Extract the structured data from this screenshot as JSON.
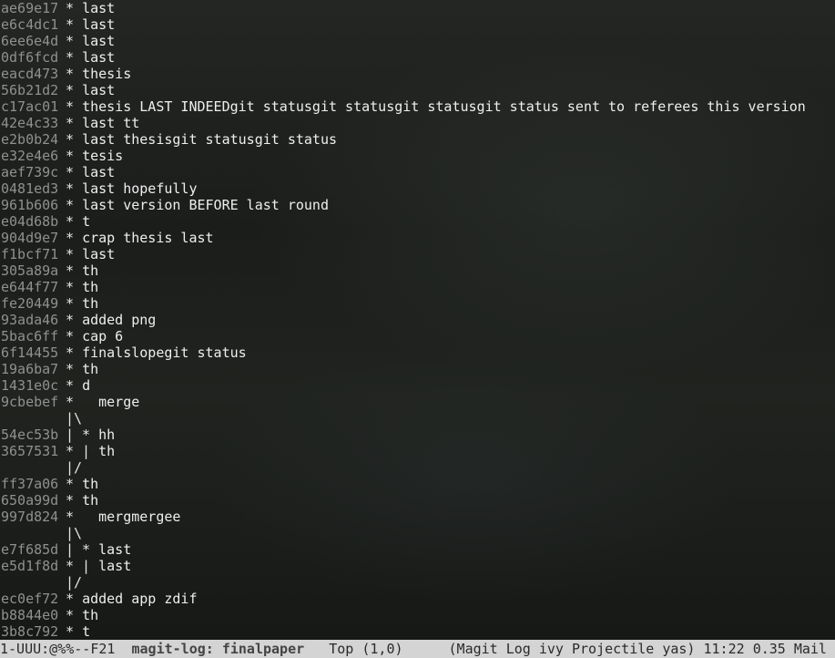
{
  "log": {
    "rows": [
      {
        "hash": "ae69e17",
        "graph": "* ",
        "message": "last"
      },
      {
        "hash": "e6c4dc1",
        "graph": "* ",
        "message": "last"
      },
      {
        "hash": "6ee6e4d",
        "graph": "* ",
        "message": "last"
      },
      {
        "hash": "0df6fcd",
        "graph": "* ",
        "message": "last"
      },
      {
        "hash": "eacd473",
        "graph": "* ",
        "message": "thesis"
      },
      {
        "hash": "56b21d2",
        "graph": "* ",
        "message": "last"
      },
      {
        "hash": "c17ac01",
        "graph": "* ",
        "message": "thesis LAST INDEEDgit statusgit statusgit statusgit status sent to referees this version"
      },
      {
        "hash": "42e4c33",
        "graph": "* ",
        "message": "last tt"
      },
      {
        "hash": "e2b0b24",
        "graph": "* ",
        "message": "last thesisgit statusgit status"
      },
      {
        "hash": "e32e4e6",
        "graph": "* ",
        "message": "tesis"
      },
      {
        "hash": "aef739c",
        "graph": "* ",
        "message": "last"
      },
      {
        "hash": "0481ed3",
        "graph": "* ",
        "message": "last hopefully"
      },
      {
        "hash": "961b606",
        "graph": "* ",
        "message": "last version BEFORE last round"
      },
      {
        "hash": "e04d68b",
        "graph": "* ",
        "message": "t"
      },
      {
        "hash": "904d9e7",
        "graph": "* ",
        "message": "crap thesis last"
      },
      {
        "hash": "f1bcf71",
        "graph": "* ",
        "message": "last"
      },
      {
        "hash": "305a89a",
        "graph": "* ",
        "message": "th"
      },
      {
        "hash": "e644f77",
        "graph": "* ",
        "message": "th"
      },
      {
        "hash": "fe20449",
        "graph": "* ",
        "message": "th"
      },
      {
        "hash": "93ada46",
        "graph": "* ",
        "message": "added png"
      },
      {
        "hash": "5bac6ff",
        "graph": "* ",
        "message": "cap 6"
      },
      {
        "hash": "6f14455",
        "graph": "* ",
        "message": "finalslopegit status"
      },
      {
        "hash": "19a6ba7",
        "graph": "* ",
        "message": "th"
      },
      {
        "hash": "1431e0c",
        "graph": "* ",
        "message": "d"
      },
      {
        "hash": "9cbebef",
        "graph": "*   ",
        "message": "merge"
      },
      {
        "hash": "",
        "graph": "|\\",
        "message": ""
      },
      {
        "hash": "54ec53b",
        "graph": "| * ",
        "message": "hh"
      },
      {
        "hash": "3657531",
        "graph": "* | ",
        "message": "th"
      },
      {
        "hash": "",
        "graph": "|/",
        "message": ""
      },
      {
        "hash": "ff37a06",
        "graph": "* ",
        "message": "th"
      },
      {
        "hash": "650a99d",
        "graph": "* ",
        "message": "th"
      },
      {
        "hash": "997d824",
        "graph": "*   ",
        "message": "mergmergee"
      },
      {
        "hash": "",
        "graph": "|\\",
        "message": ""
      },
      {
        "hash": "e7f685d",
        "graph": "| * ",
        "message": "last"
      },
      {
        "hash": "e5d1f8d",
        "graph": "* | ",
        "message": "last"
      },
      {
        "hash": "",
        "graph": "|/",
        "message": ""
      },
      {
        "hash": "ec0ef72",
        "graph": "* ",
        "message": "added app zdif"
      },
      {
        "hash": "b8844e0",
        "graph": "* ",
        "message": "th"
      },
      {
        "hash": "3b8c792",
        "graph": "* ",
        "message": "t"
      }
    ]
  },
  "modeline": {
    "state": "1-UUU:@%%--F21",
    "buffer": "magit-log: finalpaper",
    "position": "Top (1,0)",
    "modes": "(Magit Log ivy Projectile yas)",
    "time": "11:22",
    "load": "0.35",
    "mail": "Mail"
  }
}
